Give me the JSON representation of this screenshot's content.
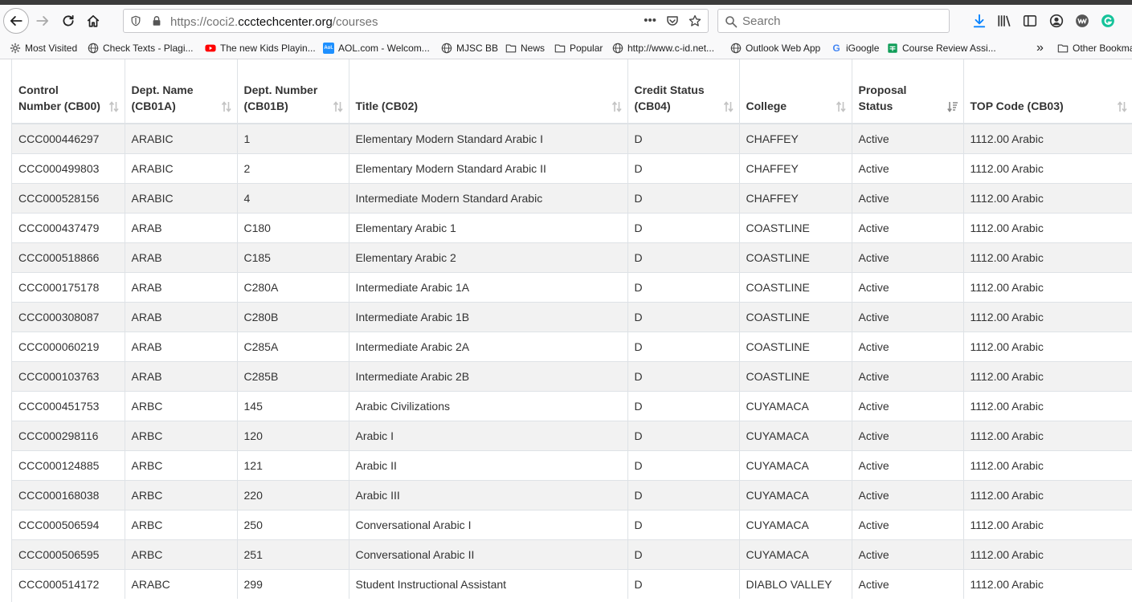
{
  "browser": {
    "url_prefix": "https://coci2.",
    "url_domain": "ccctechcenter.org",
    "url_path": "/courses",
    "page_actions_ellipsis": "•••",
    "search_placeholder": "Search"
  },
  "bookmarks": [
    {
      "label": "Most Visited",
      "icon": "gear-icon"
    },
    {
      "label": "Check Texts - Plagi...",
      "icon": "globe-icon"
    },
    {
      "label": "The new Kids Playin...",
      "icon": "youtube-icon"
    },
    {
      "label": "AOL.com - Welcom...",
      "icon": "aol-icon"
    },
    {
      "label": "MJSC BB",
      "icon": "globe-icon"
    },
    {
      "label": "News",
      "icon": "folder-icon"
    },
    {
      "label": "Popular",
      "icon": "folder-icon"
    },
    {
      "label": "http://www.c-id.net...",
      "icon": "globe-icon"
    },
    {
      "label": "Outlook Web App",
      "icon": "globe-icon"
    },
    {
      "label": "iGoogle",
      "icon": "google-icon"
    },
    {
      "label": "Course Review Assi...",
      "icon": "sheets-icon"
    },
    {
      "label": "Other Bookma",
      "icon": "folder-icon"
    }
  ],
  "bookmark_overflow": "»",
  "aol_icon_text": "Aol.",
  "google_icon_text": "G",
  "table": {
    "columns": [
      {
        "label": "Control Number (CB00)"
      },
      {
        "label": "Dept. Name (CB01A)"
      },
      {
        "label": "Dept. Number (CB01B)"
      },
      {
        "label": "Title (CB02)"
      },
      {
        "label": "Credit Status (CB04)"
      },
      {
        "label": "College"
      },
      {
        "label": "Proposal Status"
      },
      {
        "label": "TOP Code (CB03)"
      }
    ],
    "rows": [
      [
        "CCC000446297",
        "ARABIC",
        "1",
        "Elementary Modern Standard Arabic I",
        "D",
        "CHAFFEY",
        "Active",
        "1112.00 Arabic"
      ],
      [
        "CCC000499803",
        "ARABIC",
        "2",
        "Elementary Modern Standard Arabic II",
        "D",
        "CHAFFEY",
        "Active",
        "1112.00 Arabic"
      ],
      [
        "CCC000528156",
        "ARABIC",
        "4",
        "Intermediate Modern Standard Arabic",
        "D",
        "CHAFFEY",
        "Active",
        "1112.00 Arabic"
      ],
      [
        "CCC000437479",
        "ARAB",
        "C180",
        "Elementary Arabic 1",
        "D",
        "COASTLINE",
        "Active",
        "1112.00 Arabic"
      ],
      [
        "CCC000518866",
        "ARAB",
        "C185",
        "Elementary Arabic 2",
        "D",
        "COASTLINE",
        "Active",
        "1112.00 Arabic"
      ],
      [
        "CCC000175178",
        "ARAB",
        "C280A",
        "Intermediate Arabic 1A",
        "D",
        "COASTLINE",
        "Active",
        "1112.00 Arabic"
      ],
      [
        "CCC000308087",
        "ARAB",
        "C280B",
        "Intermediate Arabic 1B",
        "D",
        "COASTLINE",
        "Active",
        "1112.00 Arabic"
      ],
      [
        "CCC000060219",
        "ARAB",
        "C285A",
        "Intermediate Arabic 2A",
        "D",
        "COASTLINE",
        "Active",
        "1112.00 Arabic"
      ],
      [
        "CCC000103763",
        "ARAB",
        "C285B",
        "Intermediate Arabic 2B",
        "D",
        "COASTLINE",
        "Active",
        "1112.00 Arabic"
      ],
      [
        "CCC000451753",
        "ARBC",
        "145",
        "Arabic Civilizations",
        "D",
        "CUYAMACA",
        "Active",
        "1112.00 Arabic"
      ],
      [
        "CCC000298116",
        "ARBC",
        "120",
        "Arabic I",
        "D",
        "CUYAMACA",
        "Active",
        "1112.00 Arabic"
      ],
      [
        "CCC000124885",
        "ARBC",
        "121",
        "Arabic II",
        "D",
        "CUYAMACA",
        "Active",
        "1112.00 Arabic"
      ],
      [
        "CCC000168038",
        "ARBC",
        "220",
        "Arabic III",
        "D",
        "CUYAMACA",
        "Active",
        "1112.00 Arabic"
      ],
      [
        "CCC000506594",
        "ARBC",
        "250",
        "Conversational Arabic I",
        "D",
        "CUYAMACA",
        "Active",
        "1112.00 Arabic"
      ],
      [
        "CCC000506595",
        "ARBC",
        "251",
        "Conversational Arabic II",
        "D",
        "CUYAMACA",
        "Active",
        "1112.00 Arabic"
      ],
      [
        "CCC000514172",
        "ARABC",
        "299",
        "Student Instructional Assistant",
        "D",
        "DIABLO VALLEY",
        "Active",
        "1112.00 Arabic"
      ]
    ]
  }
}
